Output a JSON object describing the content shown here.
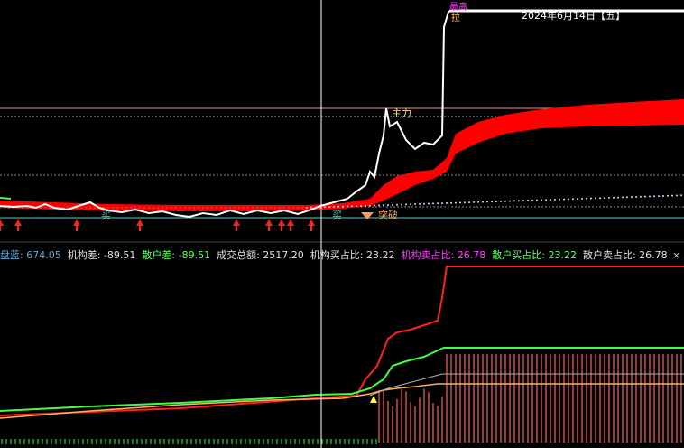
{
  "header": {
    "date": "2024年6月14日【五】"
  },
  "labels": {
    "zhuli": "主力",
    "tupo": "突破",
    "mai_left": "买",
    "mai_right": "买",
    "top_badge": "最高",
    "top_badge_lo": "拉"
  },
  "legend": {
    "items": [
      {
        "key": "盘蓝:",
        "val": "674.05",
        "color": "#5fa8d8"
      },
      {
        "key": "机构差:",
        "val": "-89.51",
        "color": "#e0e0e0"
      },
      {
        "key": "散户差:",
        "val": "-89.51",
        "color": "#5cff5c"
      },
      {
        "key": "成交总额:",
        "val": "2517.20",
        "color": "#e0e0e0"
      },
      {
        "key": "机构买占比:",
        "val": "23.22",
        "color": "#e0e0e0"
      },
      {
        "key": "机构卖占比:",
        "val": "26.78",
        "color": "#ff3cff"
      },
      {
        "key": "散户买占比:",
        "val": "23.22",
        "color": "#5cff5c"
      },
      {
        "key": "散户卖占比:",
        "val": "26.78",
        "color": "#e0e0e0"
      }
    ],
    "close": "×"
  },
  "colors": {
    "price_line": "#ffffff",
    "band": "#ff0000",
    "ref_line_pink": "#ff8c8c",
    "ref_line_grey": "#8a8a8a",
    "ref_line_teal": "#4fd0c0",
    "dots": "#cfd8ff",
    "arrow": "#ff2020",
    "red_curve": "#ff2020",
    "green_curve": "#40ff40",
    "orange_curve": "#ffb060",
    "grey_curve": "#b0b0b0",
    "vbars": "#ff6060",
    "green_bars": "#40ff40",
    "crosshair": "#ffffff"
  }
}
